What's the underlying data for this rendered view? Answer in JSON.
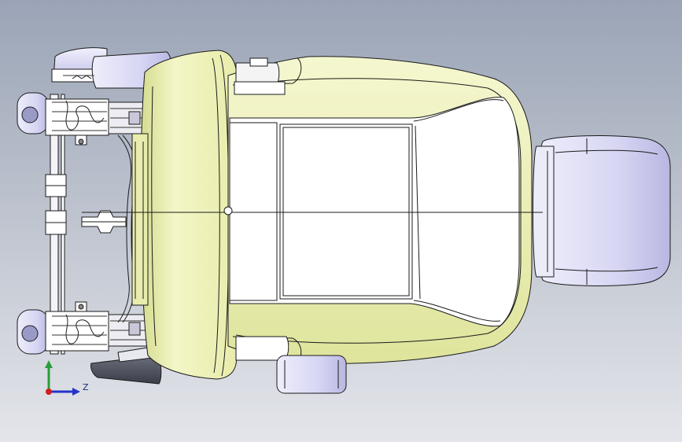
{
  "triad": {
    "z_label": "Z"
  },
  "colors": {
    "background_top": "#9aa4b6",
    "background_bottom": "#e3e5ea",
    "seat_shell": "#eef2b4",
    "seat_shell_shade": "#c9d07a",
    "seat_cushion": "#ffffff",
    "lavender_parts": "#d9d8f4",
    "lavender_shade": "#b4b2e0",
    "outline": "#1b1b1b",
    "axis_y": "#2a9d3c",
    "axis_z": "#2533c9",
    "axis_x": "#d11d1d"
  }
}
